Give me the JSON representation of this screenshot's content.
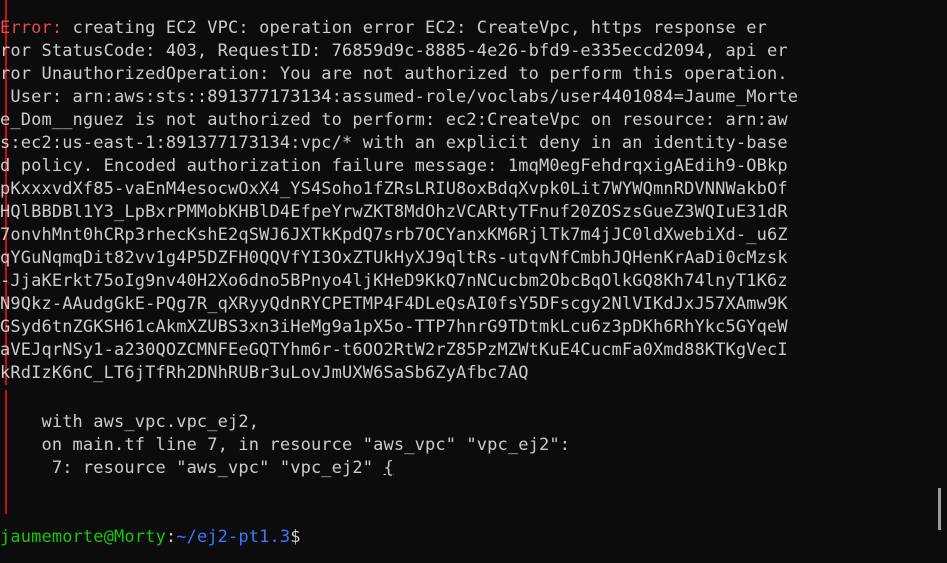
{
  "terminal": {
    "error_label": "Error:",
    "error_lines": [
      " creating EC2 VPC: operation error EC2: CreateVpc, https response er",
      "ror StatusCode: 403, RequestID: 76859d9c-8885-4e26-bfd9-e335eccd2094, api er",
      "ror UnauthorizedOperation: You are not authorized to perform this operation.",
      " User: arn:aws:sts::891377173134:assumed-role/voclabs/user4401084=Jaume_Morte",
      "e_Dom__nguez is not authorized to perform: ec2:CreateVpc on resource: arn:aw",
      "s:ec2:us-east-1:891377173134:vpc/* with an explicit deny in an identity-base",
      "d policy. Encoded authorization failure message: 1mqM0egFehdrqxigAEdih9-OBkp",
      "pKxxxvdXf85-vaEnM4esocwOxX4_YS4Soho1fZRsLRIU8oxBdqXvpk0Lit7WYWQmnRDVNNWakbOf",
      "HQlBBDBl1Y3_LpBxrPMMobKHBlD4EfpeYrwZKT8MdOhzVCARtyTFnuf20ZOSzsGueZ3WQIuE31dR",
      "7onvhMnt0hCRp3rhecKshE2qSWJ6JXTkKpdQ7srb7OCYanxKM6RjlTk7m4jJC0ldXwebiXd-_u6Z",
      "qYGuNqmqDit82vv1g4P5DZFH0QQVfYI3OxZTUkHyXJ9qltRs-utqvNfCmbhJQHenKrAaDi0cMzsk",
      "-JjaKErkt75oIg9nv40H2Xo6dno5BPnyo4ljKHeD9KkQ7nNCucbm2ObcBqOlkGQ8Kh74lnyT1K6z",
      "N9Qkz-AAudgGkE-PQg7R_qXRyyQdnRYCPETMP4F4DLeQsAI0fsY5DFscgy2NlVIKdJxJ57XAmw9K",
      "GSyd6tnZGKSH61cAkmXZUBS3xn3iHeMg9a1pX5o-TTP7hnrG9TDtmkLcu6z3pDKh6RhYkc5GYqeW",
      "aVEJqrNSy1-a230QOZCMNFEeGQTYhm6r-t6OO2RtW2rZ85PzMZWtKuE4CucmFa0Xmd88KTKgVecI",
      "kRdIzK6nC_LT6jTfRh2DNhRUBr3uLovJmUXW6SaSb6ZyAfbc7AQ"
    ],
    "context_lines": [
      "    with aws_vpc.vpc_ej2,",
      "    on main.tf line 7, in resource \"aws_vpc\" \"vpc_ej2\":",
      "     7: resource \"aws_vpc\" \"vpc_ej2\" "
    ],
    "context_brace": "{",
    "prompt": {
      "user_host": "jaumemorte@Morty",
      "separator": ":",
      "path": "~/ej2-pt1.3",
      "symbol": "$"
    }
  }
}
